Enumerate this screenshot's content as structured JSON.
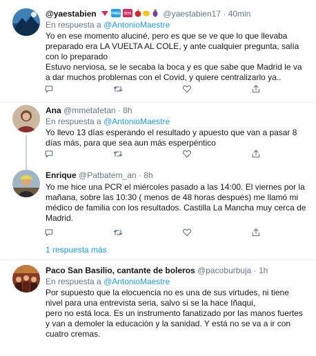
{
  "tweets": [
    {
      "name": "@yaestabien",
      "handle": "@yaestabien17",
      "dot": "·",
      "time": "40min",
      "reply_prefix": "En respuesta a",
      "reply_to": "@AntonioMaestre",
      "paragraphs": [
        "Yo en ese momento aluciné, pero es que se ve que lo que llevaba preparado era LA VUELTA AL COLE, y ante cualquier pregunta, salía con lo preparado",
        "Estuvo nerviosa, se le secaba la boca y es que sabe que Madrid le va a dar muchos problemas con el Covid, y quiere centralizarlo ya.."
      ]
    },
    {
      "name": "Ana",
      "handle": "@mmetafetan",
      "dot": "·",
      "time": "8h",
      "reply_prefix": "En respuesta a",
      "reply_to": "@AntonioMaestre",
      "paragraphs": [
        "Yo llevo 13 días esperando el resultado y apuesto que van a pasar 8 días más, para que sea aun más esperpéntico"
      ]
    },
    {
      "name": "Enrique",
      "handle": "@Patbatem_an",
      "dot": "·",
      "time": "8h",
      "paragraphs": [
        "Yo me hice una PCR el miércoles pasado a las 14:00. El viernes por la mañana, sobre las 10:30 ( menos de 48 horas después) me llamó mi médico de familia con los resultados. Castilla La Mancha muy cerca de Madrid."
      ]
    },
    {
      "name": "Paco San Basilio, cantante de boleros",
      "handle": "@pacoburbuja",
      "dot": "·",
      "time": "1h",
      "reply_prefix": "En respuesta a",
      "reply_to": "@AntonioMaestre",
      "paragraphs": [
        "Por supuesto que la elocuencia no es una de sus virtudes, ni tiene nivel para una entrevista seria, salvo si se la hace Iñaqui,",
        "pero no está loca. Es un instrumento fanatizado por las manos fuertes y van a demoler la educación y la sanidad. Y está no se va a ir con cuatro cremas."
      ]
    }
  ],
  "badges": {
    "free_label": "FREE",
    "sos_label": "SOS"
  },
  "more_replies": "1 respuesta más",
  "colors": {
    "text": "#14171a",
    "secondary": "#657786",
    "link": "#1da1f2",
    "divider": "#e6ecf0",
    "thread_line": "#ccd6dd"
  },
  "icons": [
    "comment-icon",
    "retweet-icon",
    "like-icon",
    "share-icon",
    "heart-emoji-icon",
    "free-badge-icon",
    "sos-badge-icon",
    "apple-icon",
    "lemon-icon",
    "eggplant-icon"
  ]
}
